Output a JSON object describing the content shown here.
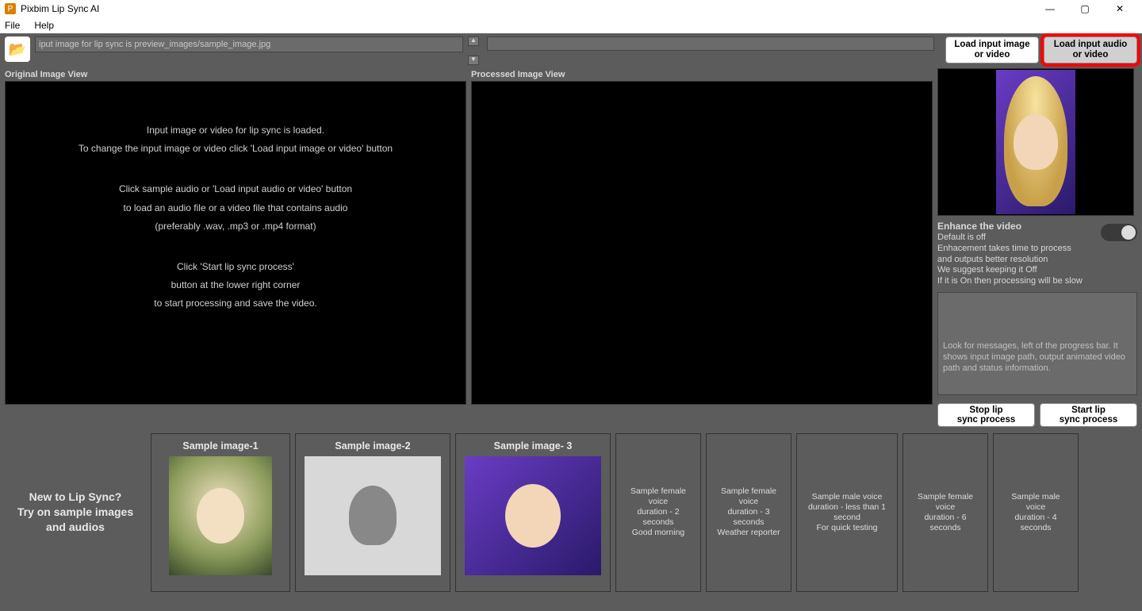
{
  "window": {
    "title": "Pixbim Lip Sync AI"
  },
  "menu": {
    "file": "File",
    "help": "Help"
  },
  "top": {
    "input_path": "iput image for lip sync is preview_images/sample_image.jpg",
    "load_image_l1": "Load input image",
    "load_image_l2": "or video",
    "load_audio_l1": "Load input audio",
    "load_audio_l2": "or video"
  },
  "views": {
    "original_label": "Original Image View",
    "processed_label": "Processed Image View",
    "p1_l1": "Input image or video for lip sync is loaded.",
    "p1_l2": "To change the input image or video click 'Load input image or video' button",
    "p2_l1": "Click sample audio or 'Load input audio or video' button",
    "p2_l2": "to load an audio file or a video file that contains audio",
    "p2_l3": "(preferably .wav, .mp3 or .mp4 format)",
    "p3_l1": "Click 'Start lip sync process'",
    "p3_l2": "button at the lower right corner",
    "p3_l3": "to start processing and save the video."
  },
  "enhance": {
    "title": "Enhance the video",
    "l1": "Default is off",
    "l2": "Enhacement takes time to process",
    "l3": "and outputs better resolution",
    "l4": "We suggest keeping it Off",
    "l5": "If it is On then processing will be slow"
  },
  "messages": {
    "text": "Look for messages, left of the progress bar. It shows input image path, output animated video path and status information."
  },
  "process": {
    "stop_l1": "Stop lip",
    "stop_l2": "sync process",
    "start_l1": "Start lip",
    "start_l2": "sync process"
  },
  "intro": {
    "l1": "New to Lip Sync?",
    "l2": "Try on sample images",
    "l3": "and audios"
  },
  "samples": {
    "img1": "Sample image-1",
    "img2": "Sample image-2",
    "img3": "Sample image- 3",
    "a1_l1": "Sample female voice",
    "a1_l2": "duration - 2 seconds",
    "a1_l3": "Good morning",
    "a2_l1": "Sample female voice",
    "a2_l2": "duration - 3 seconds",
    "a2_l3": "Weather reporter",
    "a3_l1": "Sample male voice",
    "a3_l2": "duration - less than 1 second",
    "a3_l3": "For quick testing",
    "a4_l1": "Sample female voice",
    "a4_l2": "duration - 6 seconds",
    "a5_l1": "Sample male voice",
    "a5_l2": "duration - 4 seconds"
  }
}
